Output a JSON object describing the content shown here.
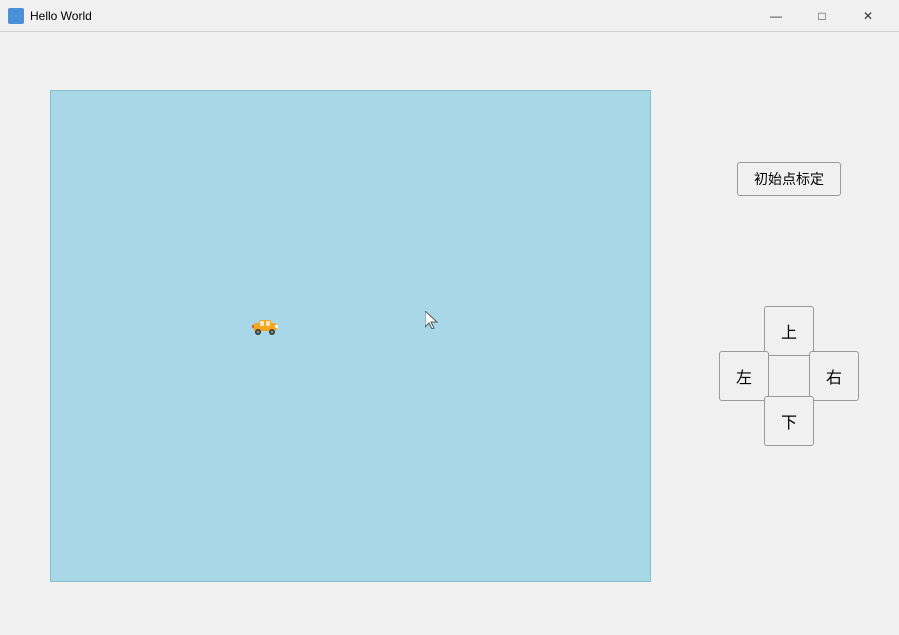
{
  "window": {
    "title": "Hello World",
    "icon_color": "#4a90d9"
  },
  "titlebar": {
    "minimize_label": "—",
    "maximize_label": "□",
    "close_label": "✕"
  },
  "controls": {
    "init_button_label": "初始点标定",
    "up_label": "上",
    "left_label": "左",
    "right_label": "右",
    "down_label": "下"
  },
  "canvas": {
    "background_color": "#a8d8e8"
  }
}
